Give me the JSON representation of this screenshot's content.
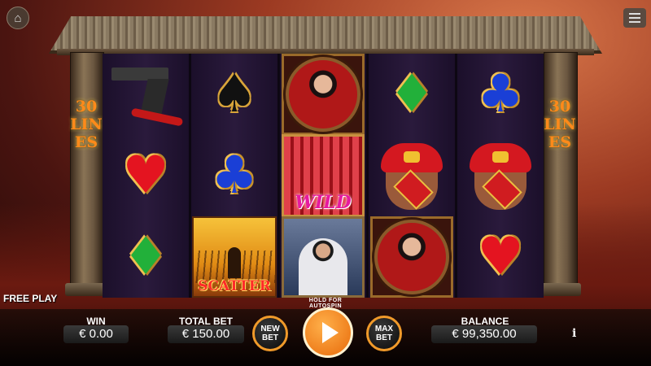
{
  "game": {
    "lines_label": "30 LINES",
    "free_play_label": "FREE PLAY",
    "wild_label": "WILD",
    "scatter_label": "SCATTER",
    "autospin_hint": "HOLD FOR AUTOSPIN"
  },
  "reels": [
    [
      "pistol",
      "heart",
      "diamond"
    ],
    [
      "spade",
      "club",
      "scatter"
    ],
    [
      "woman-portrait",
      "wild-cage",
      "hero-portrait"
    ],
    [
      "diamond",
      "wine-jar",
      "woman-portrait"
    ],
    [
      "club",
      "wine-jar",
      "heart"
    ]
  ],
  "bottom_bar": {
    "win_label": "WIN",
    "win_value": "€ 0.00",
    "total_bet_label": "TOTAL BET",
    "total_bet_value": "€ 150.00",
    "new_bet_label": "NEW BET",
    "max_bet_label": "MAX BET",
    "balance_label": "BALANCE",
    "balance_value": "€ 99,350.00",
    "info_label": "i"
  },
  "icons": {
    "home": "home-icon",
    "menu": "menu-icon",
    "spin": "play-icon"
  },
  "colors": {
    "accent": "#f09a2a",
    "lines_text": "#ff8a1a",
    "wild_text": "#e61aa0",
    "scatter_text": "#ff2a2a"
  }
}
